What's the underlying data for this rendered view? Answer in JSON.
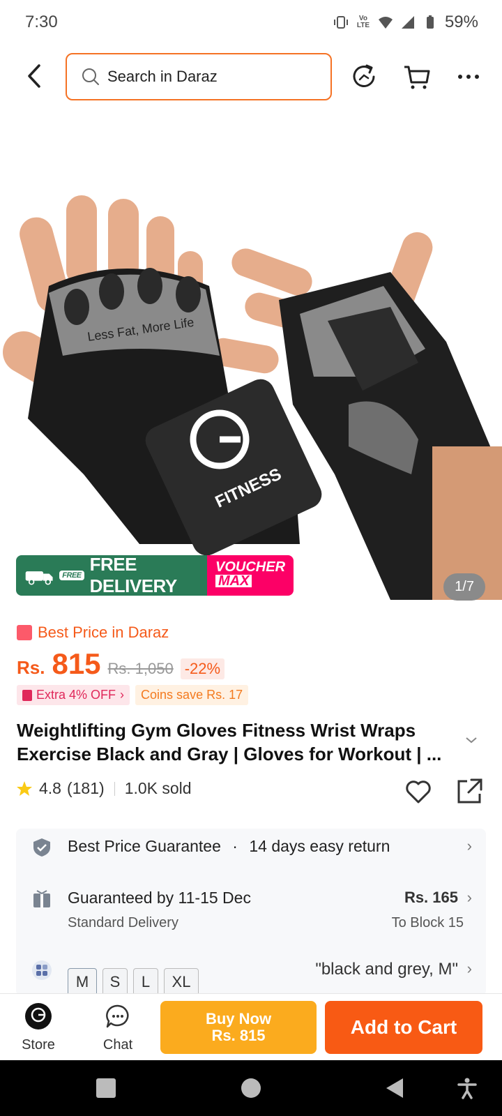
{
  "status_bar": {
    "time": "7:30",
    "volte": "Vo LTE",
    "battery": "59%"
  },
  "header": {
    "search_placeholder": "Search in Daraz"
  },
  "gallery": {
    "counter": "1/7",
    "print_text": "Less Fat, More Life",
    "brand_text": "FITNESS",
    "delivery_tag": "FREE",
    "delivery_badge": "FREE DELIVERY",
    "voucher_top": "VOUCHER",
    "voucher_bottom": "MAX"
  },
  "pricing": {
    "best_price": "Best Price in Daraz",
    "currency": "Rs.",
    "price": "815",
    "original_price": "Rs. 1,050",
    "discount": "-22%",
    "extra_off": "Extra 4% OFF",
    "coins": "Coins save Rs. 17"
  },
  "product": {
    "title": "Weightlifting Gym Gloves Fitness Wrist Wraps Exercise Black and Gray | Gloves for Workout | ...",
    "rating": "4.8",
    "reviews": "(181)",
    "sold": "1.0K sold"
  },
  "info": {
    "guarantee": "Best Price Guarantee",
    "dot": "·",
    "returns": "14 days easy return",
    "delivery_title": "Guaranteed by 11-15 Dec",
    "delivery_type": "Standard Delivery",
    "delivery_price": "Rs. 165",
    "delivery_to": "To Block 15",
    "sizes": [
      "M",
      "S",
      "L",
      "XL"
    ],
    "selected_variant": "\"black and grey, M\""
  },
  "actions": {
    "store": "Store",
    "chat": "Chat",
    "buy_now": "Buy Now",
    "buy_price": "Rs. 815",
    "add_to_cart": "Add to Cart"
  },
  "colors": {
    "accent": "#f57224",
    "buy": "#fbab1e",
    "cart": "#f85a14",
    "free_delivery": "#2a7b57",
    "voucher": "#fc0066"
  }
}
